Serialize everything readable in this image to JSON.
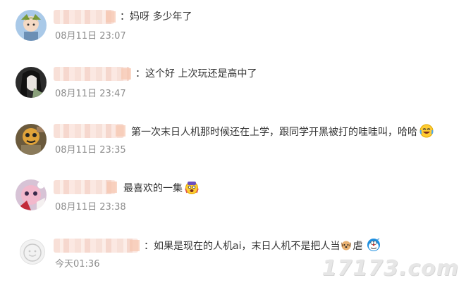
{
  "comments": [
    {
      "text": "：妈呀 多少年了",
      "time": "08月11日 23:07"
    },
    {
      "text": "：这个好 上次玩还是高中了",
      "time": "08月11日 23:47"
    },
    {
      "text": "第一次末日人机那时候还在上学，跟同学开黑被打的哇哇叫，哈哈",
      "time": "08月11日 23:35",
      "emoji": "laugh-tears-emoji"
    },
    {
      "text": "最喜欢的一集",
      "time": "08月11日 23:38",
      "emoji": "shocked-face-emoji"
    },
    {
      "text_before": "：如果是现在的人机ai，末日人机不是把人当",
      "inline_emoji": "dog-face-emoji",
      "text_after": "虐",
      "time": "今天01:36",
      "emoji": "doraemon-emoji"
    }
  ],
  "watermark": "17173.com"
}
